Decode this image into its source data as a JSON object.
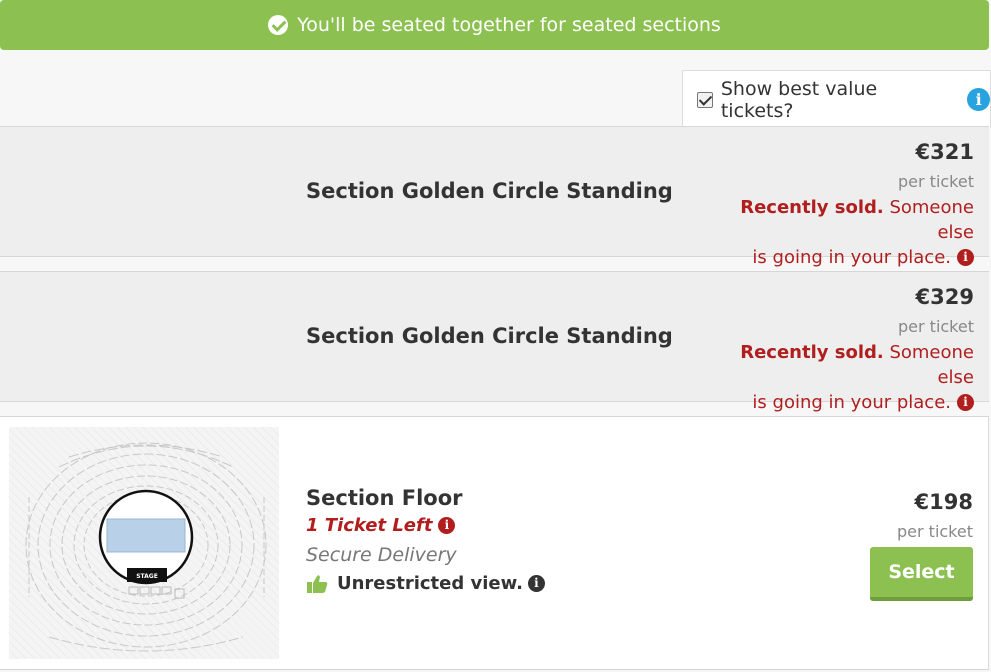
{
  "banner": {
    "text": "You'll be seated together for seated sections",
    "icon": "check-circle-icon"
  },
  "best_value": {
    "checked": true,
    "label": "Show best value tickets?",
    "icon": "info-icon"
  },
  "listings": [
    {
      "section": "Section Golden Circle Standing",
      "price": "€321",
      "per_ticket": "per ticket",
      "status_bold": "Recently sold.",
      "status_line1": "Someone else",
      "status_line2": "is going in your place."
    },
    {
      "section": "Section Golden Circle Standing",
      "price": "€329",
      "per_ticket": "per ticket",
      "status_bold": "Recently sold.",
      "status_line1": "Someone else",
      "status_line2": "is going in your place."
    },
    {
      "section": "Section Floor",
      "tickets_left": "1 Ticket Left",
      "delivery": "Secure Delivery",
      "view": "Unrestricted view.",
      "price": "€198",
      "per_ticket": "per ticket",
      "select_label": "Select",
      "map_stage_label": "STAGE"
    }
  ],
  "colors": {
    "green": "#8cc152",
    "red": "#b01e1e",
    "blue": "#29a3e0"
  }
}
